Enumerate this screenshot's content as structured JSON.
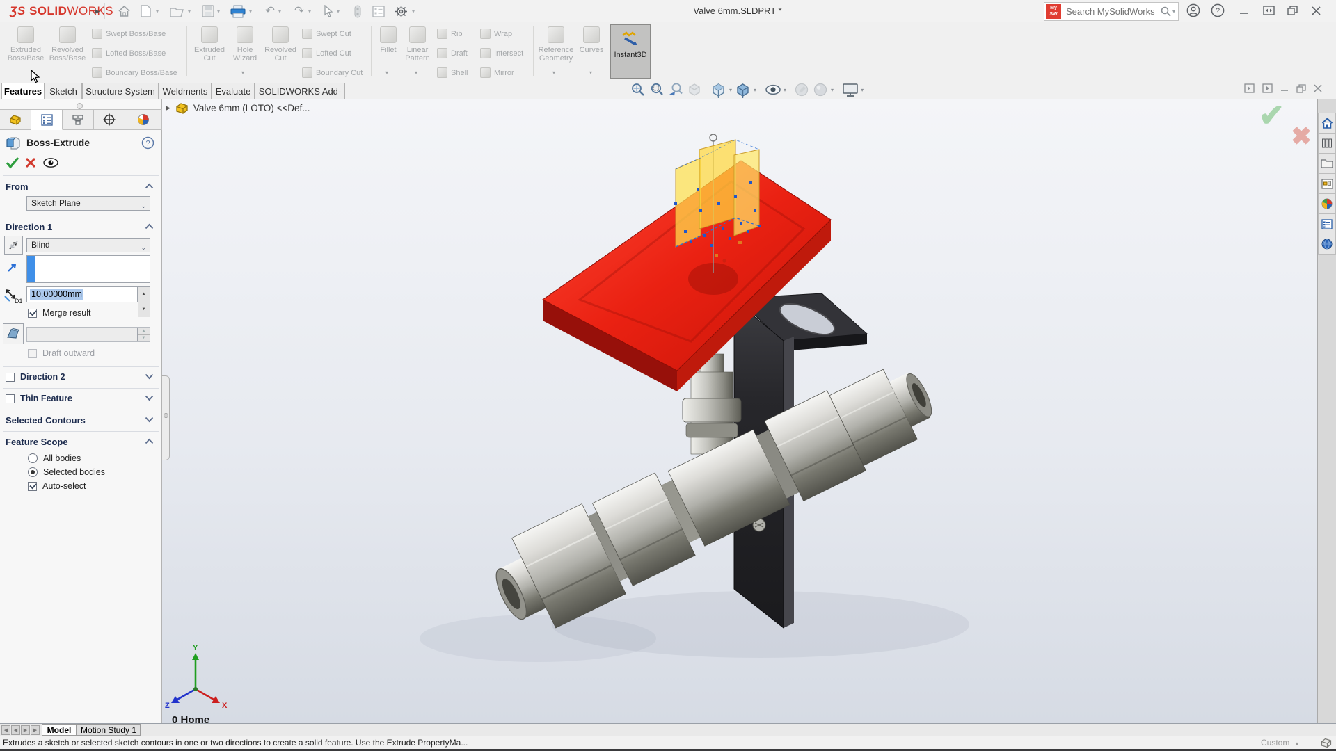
{
  "titlebar": {
    "logo_mark": "ƷS",
    "logo_solid": "SOLID",
    "logo_works": "WORKS",
    "document_title": "Valve 6mm.SLDPRT *",
    "search_placeholder": "Search MySolidWorks",
    "mysw_top": "My",
    "mysw_bottom": "SW"
  },
  "tabs": [
    "Features",
    "Sketch",
    "Structure System",
    "Weldments",
    "Evaluate",
    "SOLIDWORKS Add-Ins"
  ],
  "ribbon": {
    "extruded_boss": "Extruded Boss/Base",
    "revolved_boss": "Revolved Boss/Base",
    "swept_boss": "Swept Boss/Base",
    "lofted_boss": "Lofted Boss/Base",
    "boundary_boss": "Boundary Boss/Base",
    "extruded_cut": "Extruded Cut",
    "hole_wizard": "Hole Wizard",
    "revolved_cut": "Revolved Cut",
    "swept_cut": "Swept Cut",
    "lofted_cut": "Lofted Cut",
    "boundary_cut": "Boundary Cut",
    "fillet": "Fillet",
    "linear_pattern": "Linear Pattern",
    "rib": "Rib",
    "draft": "Draft",
    "shell": "Shell",
    "wrap": "Wrap",
    "intersect": "Intersect",
    "mirror": "Mirror",
    "reference_geometry": "Reference Geometry",
    "curves": "Curves",
    "instant3d": "Instant3D"
  },
  "property_manager": {
    "title": "Boss-Extrude",
    "from_header": "From",
    "from_value": "Sketch Plane",
    "direction1_header": "Direction 1",
    "direction1_type": "Blind",
    "depth_value": "10.00000mm",
    "merge_result": "Merge result",
    "draft_outward": "Draft outward",
    "direction2_header": "Direction 2",
    "thin_feature_header": "Thin Feature",
    "selected_contours_header": "Selected Contours",
    "feature_scope_header": "Feature Scope",
    "all_bodies": "All bodies",
    "selected_bodies": "Selected bodies",
    "auto_select": "Auto-select"
  },
  "viewport": {
    "breadcrumb": "Valve 6mm (LOTO) <<Def...",
    "home_label": "0 Home",
    "axis_x": "X",
    "axis_y": "Y",
    "axis_z": "Z"
  },
  "bottom": {
    "model_tab": "Model",
    "motion_tab": "Motion Study 1",
    "status_message": "Extrudes a sketch or selected sketch contours in one or two directions to create a solid feature. Use the Extrude PropertyMa...",
    "custom_label": "Custom"
  },
  "colors": {
    "handle_red": "#e02113",
    "preview_yellow": "#ffd94d",
    "selection_blue": "#3f8fe8",
    "confirm_green": "#2e9e3e",
    "cancel_red": "#d23a2e",
    "logo_red": "#d6372c"
  }
}
